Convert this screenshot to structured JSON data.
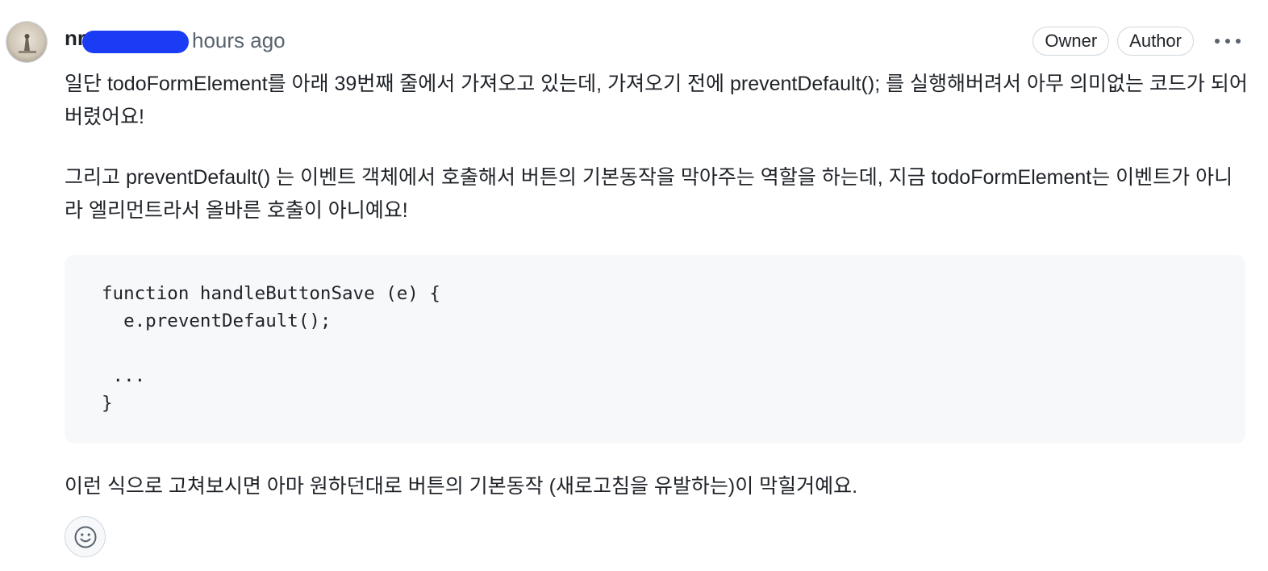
{
  "comment": {
    "author": "nr",
    "timestamp": "hours ago",
    "badges": {
      "owner": "Owner",
      "author": "Author"
    },
    "paragraphs": [
      "일단 todoFormElement를 아래 39번째 줄에서 가져오고 있는데, 가져오기 전에 preventDefault(); 를 실행해버려서 아무 의미없는 코드가 되어버렸어요!",
      "그리고 preventDefault() 는 이벤트 객체에서 호출해서 버튼의 기본동작을 막아주는 역할을 하는데, 지금 todoFormElement는 이벤트가 아니라 엘리먼트라서 올바른 호출이 아니예요!",
      "이런 식으로 고쳐보시면 아마 원하던대로 버튼의 기본동작 (새로고침을 유발하는)이 막힐거예요."
    ],
    "code": "function handleButtonSave (e) {\n  e.preventDefault();\n\n ...\n}"
  },
  "icons": {
    "avatar": "avatar-image",
    "more": "kebab-horizontal-icon",
    "reaction": "smiley-icon"
  },
  "colors": {
    "redaction": "#1a3cf5",
    "muted_text": "#59636e",
    "border": "#d0d7de",
    "code_bg": "#f6f8fa"
  }
}
